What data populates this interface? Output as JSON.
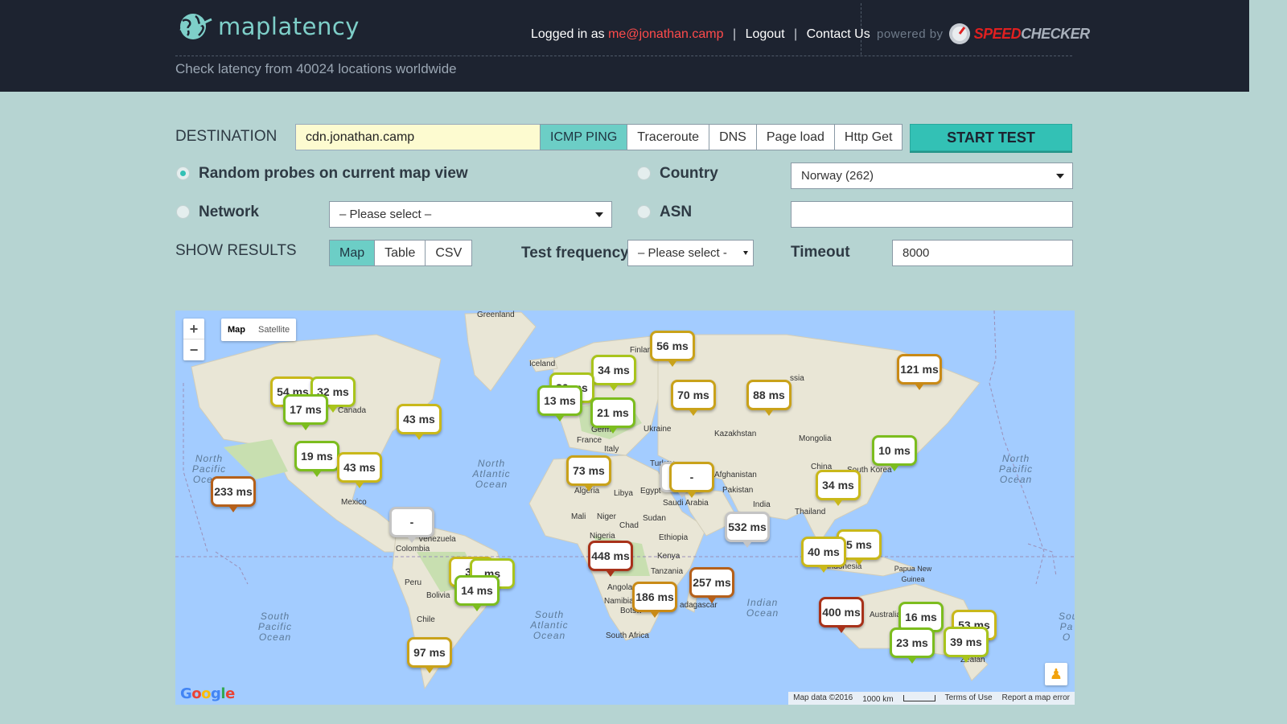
{
  "header": {
    "logo_text": "maplatency",
    "tagline": "Check latency from 40024 locations worldwide",
    "logged_in_prefix": "Logged in as",
    "user_email": "me@jonathan.camp",
    "separator": "|",
    "logout": "Logout",
    "contact": "Contact Us",
    "powered_by": "powered by",
    "brand_speed": "SPEED",
    "brand_checker": "CHECKER"
  },
  "form": {
    "destination_label": "DESTINATION",
    "destination_value": "cdn.jonathan.camp",
    "methods": [
      "ICMP PING",
      "Traceroute",
      "DNS",
      "Page load",
      "Http Get"
    ],
    "active_method": "ICMP PING",
    "start_button": "START TEST",
    "random_probes_label": "Random probes on current map view",
    "country_label": "Country",
    "country_value": "Norway (262)",
    "network_label": "Network",
    "network_value": "– Please select –",
    "asn_label": "ASN",
    "asn_value": "",
    "show_results_label": "SHOW RESULTS",
    "show_options": [
      "Map",
      "Table",
      "CSV"
    ],
    "active_show": "Map",
    "frequency_label": "Test frequency",
    "frequency_value": "– Please select -",
    "timeout_label": "Timeout",
    "timeout_value": "8000"
  },
  "map": {
    "zoom_in": "+",
    "zoom_out": "−",
    "type_map": "Map",
    "type_satellite": "Satellite",
    "google": "Google",
    "attrib_data": "Map data ©2016",
    "attrib_scale": "1000 km",
    "attrib_terms": "Terms of Use",
    "attrib_report": "Report a map error",
    "place_labels": [
      "Greenland",
      "Iceland",
      "Finlan",
      "Canada",
      "North Pacific Ocean",
      "Mexico",
      "North Atlantic Ocean",
      "Venezuela",
      "Colombia",
      "Peru",
      "Bolivia",
      "Chile",
      "South Pacific Ocean",
      "South Atlantic Ocean",
      "France",
      "Germ",
      "Italy",
      "Ukraine",
      "Kazakhstan",
      "Mongolia",
      "China",
      "South Korea",
      "ssia",
      "Turkey",
      "Afghanistan",
      "Pakistan",
      "India",
      "Thailand",
      "Egypt",
      "Libya",
      "Algeria",
      "Mali",
      "Niger",
      "Chad",
      "Sudan",
      "Nigeria",
      "Ethiopia",
      "Saudi Arabia",
      "Kenya",
      "Tanzania",
      "Angola",
      "Namibia",
      "Botsw",
      "South Africa",
      "adagascar",
      "Indian Ocean",
      "Indonesia",
      "Papua New Guinea",
      "Australia",
      "Zealan",
      "North Pacific Ocean",
      "South Pa O"
    ],
    "markers": [
      {
        "label": "56 ms",
        "color": "#c9a21a"
      },
      {
        "label": "121 ms",
        "color": "#c98a16"
      },
      {
        "label": "54 ms",
        "color": "#c9b81a"
      },
      {
        "label": "32 ms",
        "color": "#a9c41c"
      },
      {
        "label": "17 ms",
        "color": "#7cbd1e"
      },
      {
        "label": "43 ms",
        "color": "#c9b81a"
      },
      {
        "label": "34 ms",
        "color": "#a9c41c"
      },
      {
        "label": "30 ms",
        "color": "#a9c41c"
      },
      {
        "label": "13 ms",
        "color": "#7cbd1e"
      },
      {
        "label": "21 ms",
        "color": "#7cbd1e"
      },
      {
        "label": "70 ms",
        "color": "#c9a21a"
      },
      {
        "label": "88 ms",
        "color": "#c9a21a"
      },
      {
        "label": "10 ms",
        "color": "#7cbd1e"
      },
      {
        "label": "19 ms",
        "color": "#7cbd1e"
      },
      {
        "label": "43 ms",
        "color": "#c9b81a"
      },
      {
        "label": "233 ms",
        "color": "#b5601a"
      },
      {
        "label": "73 ms",
        "color": "#c9a21a"
      },
      {
        "label": "-",
        "color": "#c4c4c4"
      },
      {
        "label": "34 ms",
        "color": "#c9b81a"
      },
      {
        "label": "-",
        "color": "#c9a21a"
      },
      {
        "label": "-",
        "color": "#c4c4c4"
      },
      {
        "label": "532 ms",
        "color": "#c4c4c4"
      },
      {
        "label": "5 ms",
        "color": "#c9b81a"
      },
      {
        "label": "40 ms",
        "color": "#c9b81a"
      },
      {
        "label": "448 ms",
        "color": "#a8321a"
      },
      {
        "label": "257 ms",
        "color": "#b5601a"
      },
      {
        "label": "30",
        "color": "#c9b81a"
      },
      {
        "label": "ms",
        "color": "#a9c41c"
      },
      {
        "label": "14 ms",
        "color": "#7cbd1e"
      },
      {
        "label": "186 ms",
        "color": "#c98a16"
      },
      {
        "label": "400 ms",
        "color": "#a8321a"
      },
      {
        "label": "16 ms",
        "color": "#7cbd1e"
      },
      {
        "label": "53 ms",
        "color": "#c9b81a"
      },
      {
        "label": "23 ms",
        "color": "#7cbd1e"
      },
      {
        "label": "39 ms",
        "color": "#a9c41c"
      },
      {
        "label": "97 ms",
        "color": "#c9a21a"
      }
    ]
  }
}
